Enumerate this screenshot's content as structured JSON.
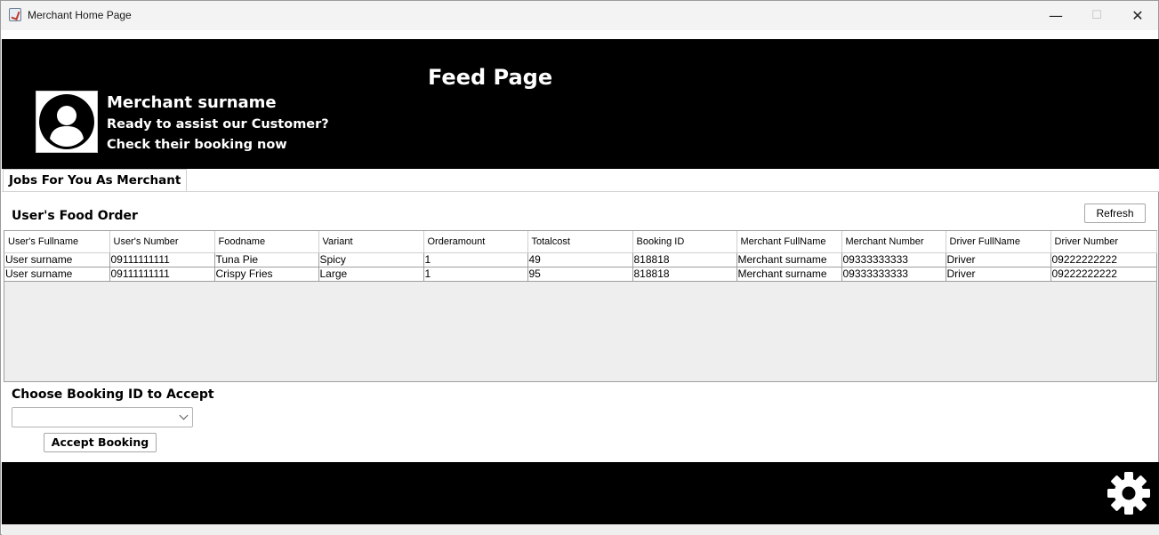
{
  "window": {
    "title": "Merchant Home Page"
  },
  "controls": {
    "minimize": "—",
    "maximize": "☐",
    "close": "✕"
  },
  "header": {
    "title": "Feed Page",
    "merchant_name": "Merchant surname",
    "line1": "Ready to assist our Customer?",
    "line2": "Check their booking now",
    "avatar_icon": "user-avatar-icon"
  },
  "tabs": [
    {
      "label": "Jobs For You As Merchant",
      "selected": true
    }
  ],
  "orders": {
    "title": "User's Food Order",
    "refresh_label": "Refresh",
    "columns": [
      "User's Fullname",
      "User's Number",
      "Foodname",
      "Variant",
      "Orderamount",
      "Totalcost",
      "Booking ID",
      "Merchant FullName",
      "Merchant Number",
      "Driver FullName",
      "Driver Number"
    ],
    "rows": [
      [
        "User surname",
        "09111111111",
        "Tuna Pie",
        "Spicy",
        "1",
        "49",
        "818818",
        "Merchant surname",
        "09333333333",
        "Driver",
        "09222222222"
      ],
      [
        "User surname",
        "09111111111",
        "Crispy Fries",
        "Large",
        "1",
        "95",
        "818818",
        "Merchant surname",
        "09333333333",
        "Driver",
        "09222222222"
      ]
    ]
  },
  "booking": {
    "choose_label": "Choose Booking ID to Accept",
    "selected_value": "",
    "accept_label": "Accept Booking"
  },
  "footer": {
    "settings_icon": "gear-icon"
  },
  "colors": {
    "header_bg": "#000000",
    "table_empty_bg": "#eeeeee",
    "text_light": "#ffffff"
  }
}
